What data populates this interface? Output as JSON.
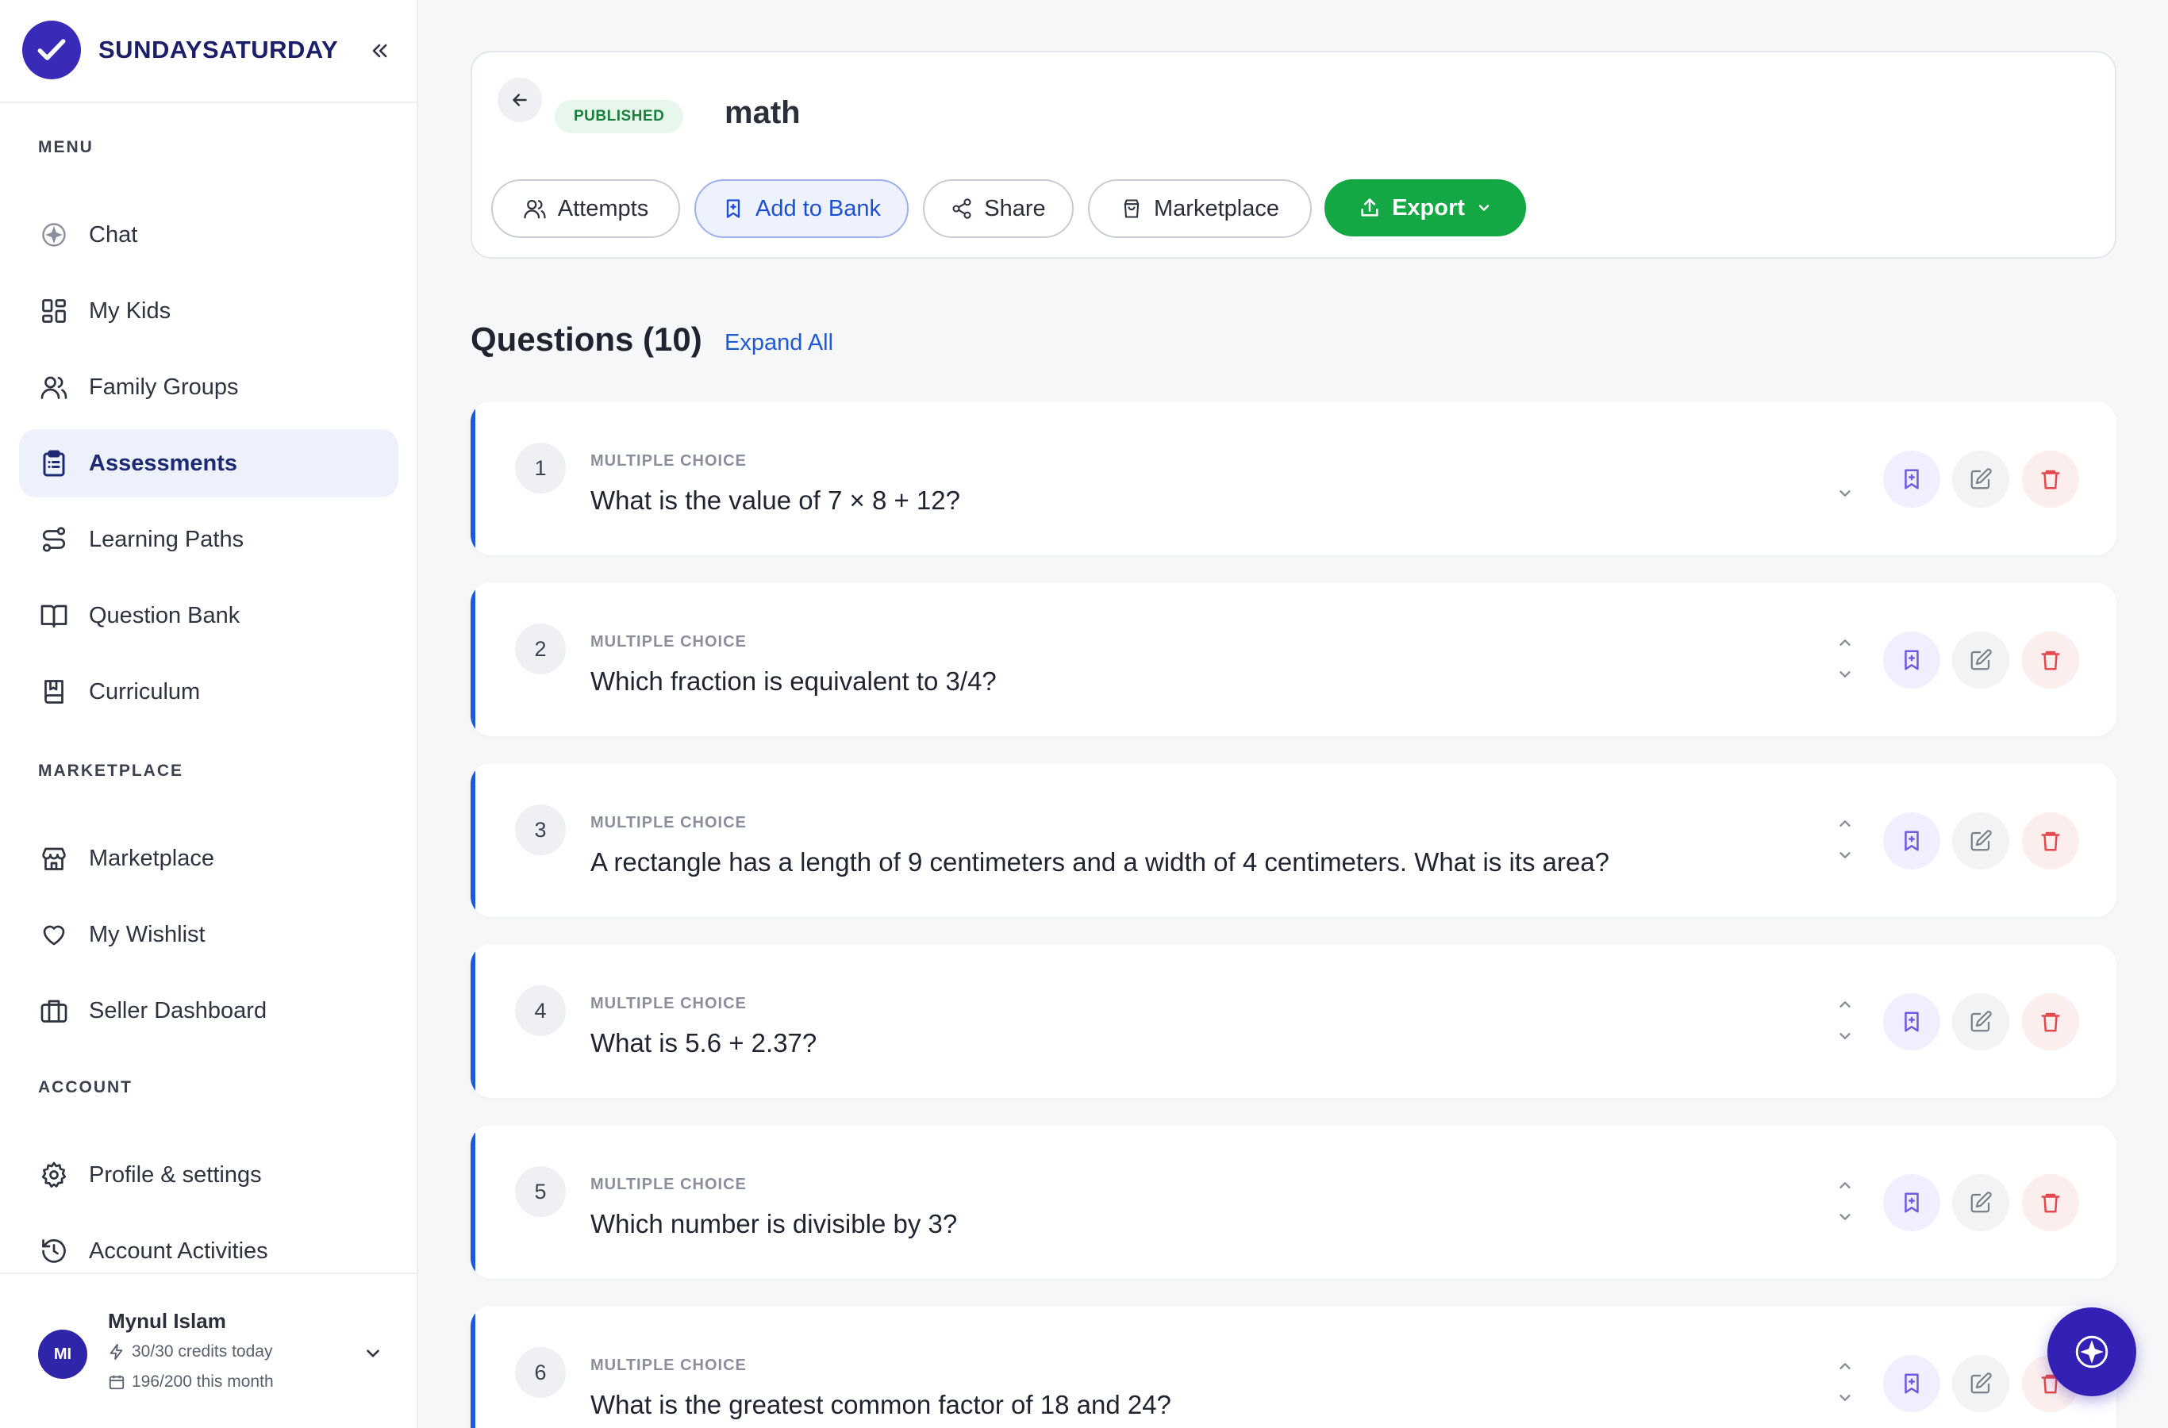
{
  "brand": {
    "name": "SUNDAYSATURDAY"
  },
  "sidebar": {
    "sections": {
      "menu": "MENU",
      "marketplace": "MARKETPLACE",
      "account": "ACCOUNT"
    },
    "menu_items": [
      {
        "label": "Chat",
        "icon": "chat-sparkle-icon"
      },
      {
        "label": "My Kids",
        "icon": "grid-icon"
      },
      {
        "label": "Family Groups",
        "icon": "users-icon"
      },
      {
        "label": "Assessments",
        "icon": "clipboard-icon",
        "active": true
      },
      {
        "label": "Learning Paths",
        "icon": "route-icon"
      },
      {
        "label": "Question Bank",
        "icon": "book-open-icon"
      },
      {
        "label": "Curriculum",
        "icon": "book-icon"
      }
    ],
    "marketplace_items": [
      {
        "label": "Marketplace",
        "icon": "store-icon"
      },
      {
        "label": "My Wishlist",
        "icon": "heart-icon"
      },
      {
        "label": "Seller Dashboard",
        "icon": "briefcase-icon"
      }
    ],
    "account_items": [
      {
        "label": "Profile & settings",
        "icon": "gear-icon"
      },
      {
        "label": "Account Activities",
        "icon": "history-icon"
      }
    ]
  },
  "profile": {
    "initials": "MI",
    "name": "Mynul Islam",
    "credits_today": "30/30 credits today",
    "credits_month": "196/200 this month"
  },
  "header": {
    "status": "PUBLISHED",
    "title": "math",
    "actions": {
      "attempts": "Attempts",
      "add_to_bank": "Add to Bank",
      "share": "Share",
      "marketplace": "Marketplace",
      "export": "Export"
    }
  },
  "questions": {
    "heading": "Questions (10)",
    "expand_all": "Expand All",
    "items": [
      {
        "number": "1",
        "type": "MULTIPLE CHOICE",
        "text": "What is the value of 7 × 8 + 12?"
      },
      {
        "number": "2",
        "type": "MULTIPLE CHOICE",
        "text": "Which fraction is equivalent to 3/4?"
      },
      {
        "number": "3",
        "type": "MULTIPLE CHOICE",
        "text": "A rectangle has a length of 9 centimeters and a width of 4 centimeters. What is its area?"
      },
      {
        "number": "4",
        "type": "MULTIPLE CHOICE",
        "text": "What is 5.6 + 2.37?"
      },
      {
        "number": "5",
        "type": "MULTIPLE CHOICE",
        "text": "Which number is divisible by 3?"
      },
      {
        "number": "6",
        "type": "MULTIPLE CHOICE",
        "text": "What is the greatest common factor of 18 and 24?"
      }
    ]
  },
  "colors": {
    "brand": "#3a2ab8",
    "accent_blue": "#1d5ad6",
    "export_green": "#13a843",
    "published_green": "#1a7f3c",
    "delete_red": "#e5484d"
  }
}
